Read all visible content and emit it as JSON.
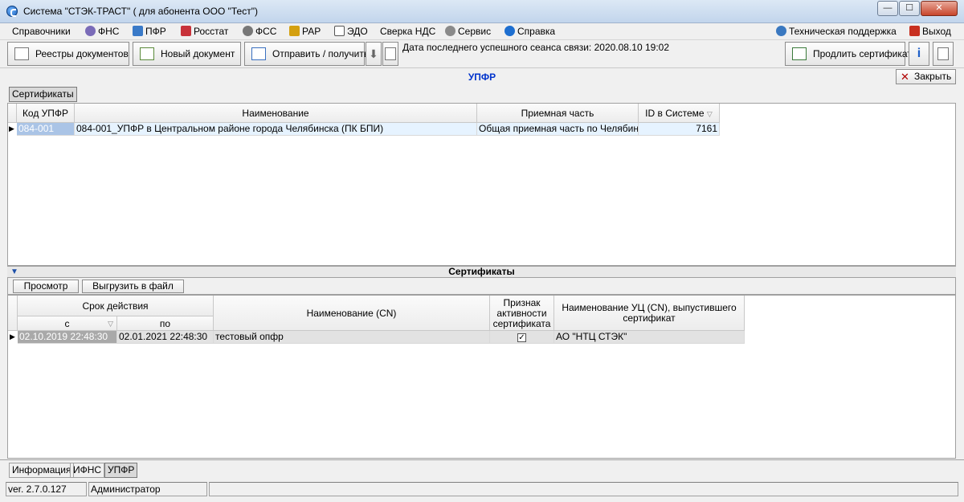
{
  "window": {
    "title": "Система \"СТЭК-ТРАСТ\" ( для абонента ООО \"Тест\")",
    "min": "—",
    "max": "☐",
    "close": "✕"
  },
  "menu": {
    "items": [
      {
        "label": "Справочники",
        "icon": "",
        "color": ""
      },
      {
        "label": "ФНС",
        "icon": "fns-icon",
        "color": "#7a6bb8"
      },
      {
        "label": "ПФР",
        "icon": "pfr-icon",
        "color": "#3a7ac8"
      },
      {
        "label": "Росстат",
        "icon": "rosstat-icon",
        "color": "#c8323a"
      },
      {
        "label": "ФСС",
        "icon": "fss-icon",
        "color": "#777777"
      },
      {
        "label": "РАР",
        "icon": "rar-icon",
        "color": "#d4a010"
      },
      {
        "label": "ЭДО",
        "icon": "edo-icon",
        "color": "#555555"
      },
      {
        "label": "Сверка НДС",
        "icon": "",
        "color": ""
      },
      {
        "label": "Сервис",
        "icon": "gear-icon",
        "color": "#8a8a8a"
      },
      {
        "label": "Справка",
        "icon": "help-icon",
        "color": "#1e6fd0"
      }
    ],
    "support": "Техническая поддержка",
    "exit": "Выход"
  },
  "toolbar": {
    "registry": "Реестры документов",
    "new_doc": "Новый документ",
    "send_receive": "Отправить / получить",
    "session": "Дата последнего успешного сеанса связи: 2020.08.10 19:02",
    "renew_cert": "Продлить сертификат"
  },
  "section": {
    "title": "УПФР",
    "close": "Закрыть",
    "tab": "Сертификаты"
  },
  "upfr_table": {
    "columns": [
      "Код УПФР",
      "Наименование",
      "Приемная часть",
      "ID в Системе"
    ],
    "rows": [
      {
        "code": "084-001",
        "name": "084-001_УПФР в Центральном районе города Челябинска (ПК БПИ)",
        "reception": "Общая приемная часть по Челябинс...",
        "id": "7161"
      }
    ]
  },
  "certs": {
    "title": "Сертификаты",
    "view": "Просмотр",
    "export": "Выгрузить в файл",
    "columns": {
      "validity": "Срок действия",
      "from": "с",
      "to": "по",
      "cn": "Наименование (CN)",
      "active": "Признак активности сертификата",
      "issuer": "Наименование УЦ (CN), выпустившего сертификат"
    },
    "rows": [
      {
        "from": "02.10.2019 22:48:30",
        "to": "02.01.2021 22:48:30",
        "cn": "тестовый опфр",
        "active": "✓",
        "issuer": "АО \"НТЦ СТЭК\""
      }
    ]
  },
  "bottom_tabs": [
    "Информация",
    "ИФНС",
    "УПФР"
  ],
  "status": {
    "version": "ver. 2.7.0.127",
    "user": "Администратор"
  }
}
